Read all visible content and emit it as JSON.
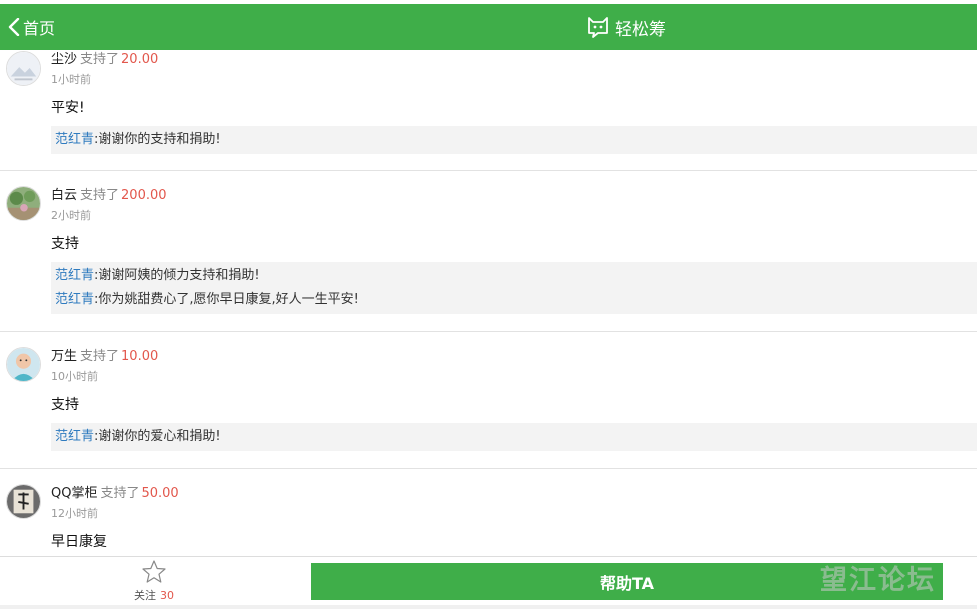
{
  "header": {
    "back_label": "首页",
    "brand_name": "轻松筹",
    "bg_color": "#3fae49"
  },
  "feed": {
    "supported_label": "支持了",
    "entries": [
      {
        "name": "尘沙",
        "amount": "20.00",
        "time": "1小时前",
        "message": "平安!",
        "replies": [
          {
            "name": "范红青",
            "sep": ":",
            "text": "谢谢你的支持和捐助!"
          }
        ]
      },
      {
        "name": "白云",
        "amount": "200.00",
        "time": "2小时前",
        "message": "支持",
        "replies": [
          {
            "name": "范红青",
            "sep": ":",
            "text": "谢谢阿姨的倾力支持和捐助!"
          },
          {
            "name": "范红青",
            "sep": ":",
            "text": "你为姚甜费心了,愿你早日康复,好人一生平安!"
          }
        ]
      },
      {
        "name": "万生",
        "amount": "10.00",
        "time": "10小时前",
        "message": "支持",
        "replies": [
          {
            "name": "范红青",
            "sep": ":",
            "text": "谢谢你的爱心和捐助!"
          }
        ]
      },
      {
        "name": "QQ掌柜",
        "amount": "50.00",
        "time": "12小时前",
        "message": "早日康复",
        "replies": []
      }
    ]
  },
  "bottom": {
    "follow_label": "关注",
    "follow_count": "30",
    "help_label": "帮助TA",
    "watermark": "望江论坛"
  },
  "colors": {
    "accent_green": "#3fae49",
    "amount_red": "#e2574c",
    "reply_name_blue": "#2f7bbf"
  },
  "icons": [
    "chevron-left-icon",
    "cat-logo-icon",
    "star-outline-icon"
  ]
}
